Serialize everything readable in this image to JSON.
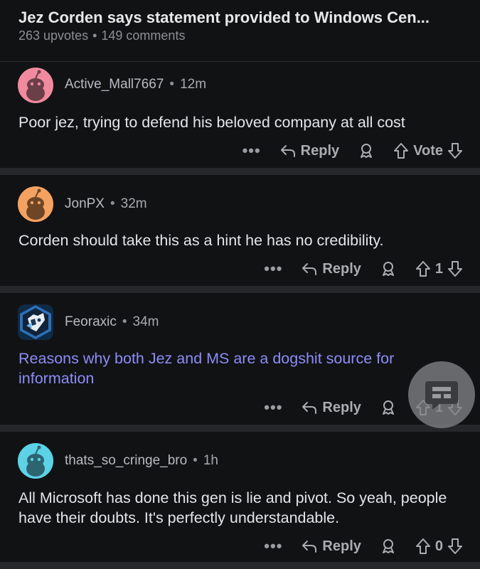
{
  "post": {
    "title": "Jez Corden says statement provided to Windows Cen...",
    "upvotes": "263 upvotes",
    "comments": "149 comments"
  },
  "comments": [
    {
      "username": "Active_Mall7667",
      "time": "12m",
      "text": "Poor jez, trying to defend his beloved company at all cost",
      "reply_label": "Reply",
      "vote": "Vote",
      "avatar_color": "#f08a9e"
    },
    {
      "username": "JonPX",
      "time": "32m",
      "text": "Corden should take this as a hint he has no credibility.",
      "reply_label": "Reply",
      "vote": "1",
      "avatar_color": "#f5a261"
    },
    {
      "username": "Feoraxic",
      "time": "34m",
      "text": "Reasons why both Jez and MS are a dogshit source for information",
      "reply_label": "Reply",
      "vote": "1",
      "avatar_color": "#4aa3e0"
    },
    {
      "username": "thats_so_cringe_bro",
      "time": "1h",
      "text": "All Microsoft has done this gen is lie and pivot. So yeah, people have their doubts. It's perfectly understandable.",
      "reply_label": "Reply",
      "vote": "0",
      "avatar_color": "#5cd2e6"
    }
  ],
  "more_glyph": "•••",
  "dot_sep": "•",
  "colors": {
    "background": "#111214",
    "link": "#8c8df7",
    "separator": "#26272a"
  }
}
